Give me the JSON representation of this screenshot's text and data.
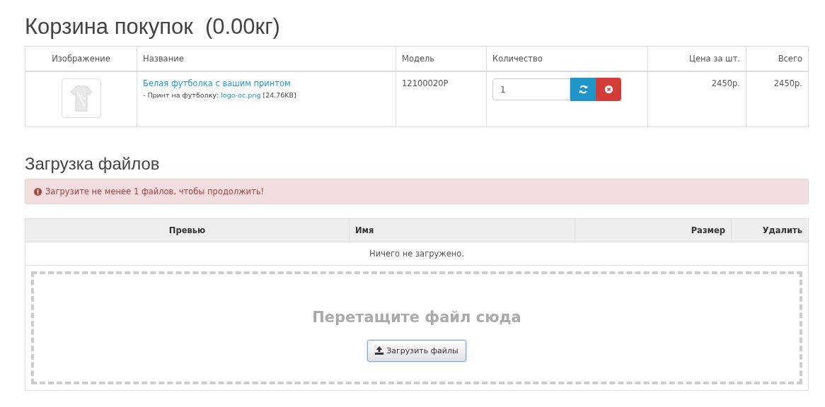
{
  "cart": {
    "title": "Корзина покупок  (0.00кг)",
    "columns": [
      "Изображение",
      "Название",
      "Модель",
      "Количество",
      "Цена за шт.",
      "Всего"
    ],
    "rows": [
      {
        "kind": "picture",
        "name": "Белая футболка с вашим принтом",
        "option": {
          "label": "- Принт на футболку:",
          "file": "logo-oc.png",
          "size": "[24.76KB]"
        },
        "model": "12100020P",
        "quantity": "1",
        "price": "2450р.",
        "total": "2450р."
      }
    ]
  },
  "uploads": {
    "title": "Загрузка файлов",
    "alert": "Загрузите не менее 1 файлов, чтобы продолжить!",
    "columns": [
      "Превью",
      "Имя",
      "Размер",
      "Удалить"
    ],
    "empty": "Ничего не загружено.",
    "dropzone": {
      "hint": "Перетащите файл сюда",
      "button": "Загрузить файлы"
    }
  }
}
